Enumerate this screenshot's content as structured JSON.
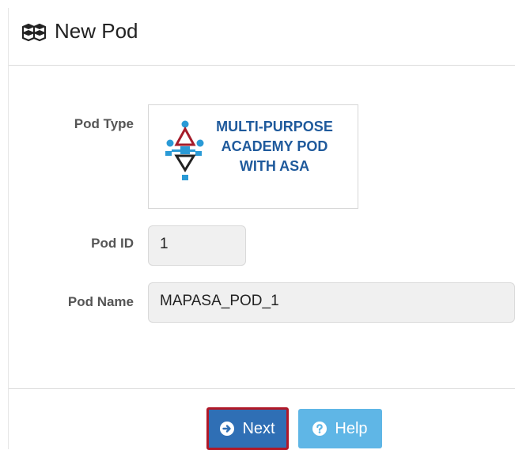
{
  "header": {
    "title": "New Pod",
    "icon": "cubes-icon"
  },
  "form": {
    "pod_type_label": "Pod Type",
    "pod_type_name_lines": [
      "MULTI-PURPOSE",
      "ACADEMY POD",
      "WITH ASA"
    ],
    "pod_id_label": "Pod ID",
    "pod_id_value": "1",
    "pod_name_label": "Pod Name",
    "pod_name_value": "MAPASA_POD_1"
  },
  "buttons": {
    "next_label": "Next",
    "next_icon": "arrow-circle-right-icon",
    "help_label": "Help",
    "help_icon": "question-circle-icon"
  },
  "colors": {
    "primary": "#2f6fb5",
    "info": "#5fb6e6",
    "highlight": "#b01828",
    "logo_text": "#1f5a9c"
  }
}
